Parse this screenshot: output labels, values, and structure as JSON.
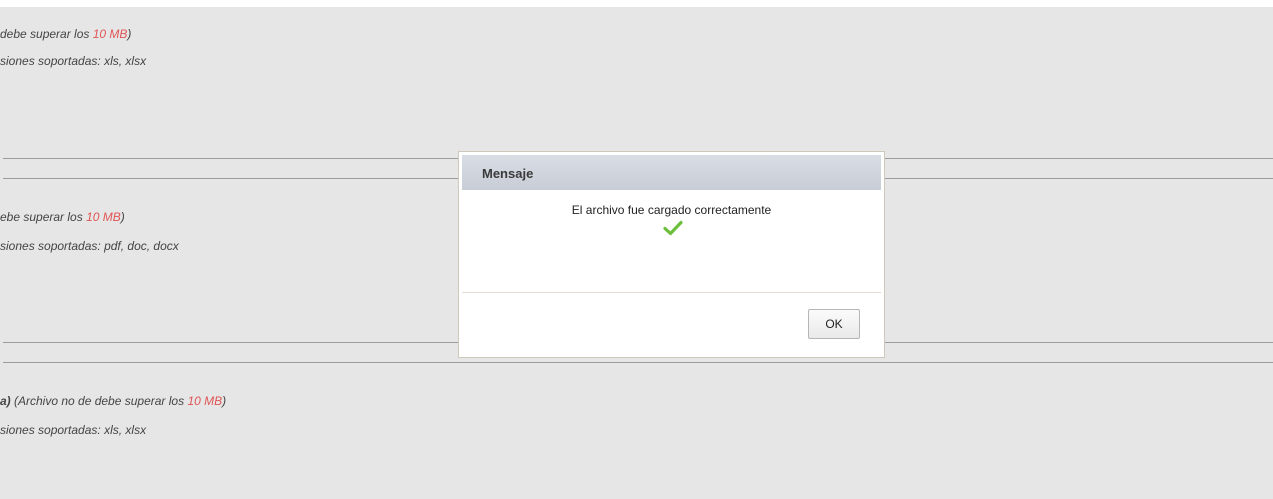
{
  "sections": [
    {
      "line1": {
        "pre": "",
        "bold": "",
        "text": "debe superar los ",
        "size": "10 MB",
        "close": ")"
      },
      "line2": "siones soportadas: xls, xlsx"
    },
    {
      "line1": {
        "pre": "",
        "bold": "",
        "text": "ebe superar los ",
        "size": "10 MB",
        "close": ")"
      },
      "line2": "siones soportadas: pdf, doc, docx"
    },
    {
      "line1": {
        "pre": "",
        "bold": "a)",
        "text": " (Archivo no de debe superar los ",
        "size": "10 MB",
        "close": ")"
      },
      "line2": "siones soportadas: xls, xlsx"
    }
  ],
  "dialog": {
    "title": "Mensaje",
    "message": "El archivo fue cargado correctamente",
    "icon": "check-icon",
    "ok_label": "OK"
  },
  "colors": {
    "background": "#e6e6e6",
    "highlight": "#e05555",
    "check": "#6bbf3a"
  }
}
